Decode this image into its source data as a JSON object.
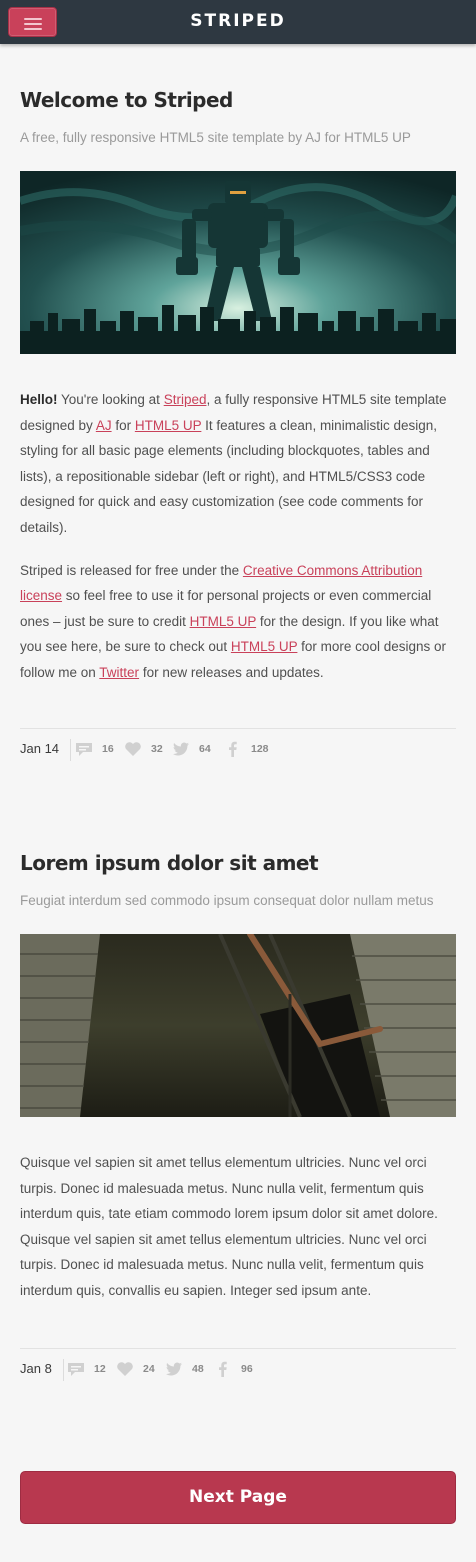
{
  "header": {
    "title": "STRIPED",
    "menu_icon": "menu-icon"
  },
  "posts": [
    {
      "title": "Welcome to Striped",
      "subtitle": "A free, fully responsive HTML5 site template by AJ for HTML5 UP",
      "paragraph1": {
        "hello": "Hello!",
        "t1": " You're looking at ",
        "link1": "Striped",
        "t2": ", a fully responsive HTML5 site template designed by ",
        "link2": "AJ",
        "t3": " for ",
        "link3": "HTML5 UP",
        "t4": " It features a clean, minimalistic design, styling for all basic page elements (including blockquotes, tables and lists), a repositionable sidebar (left or right), and HTML5/CSS3 code designed for quick and easy customization (see code comments for details)."
      },
      "paragraph2": {
        "t1": "Striped is released for free under the ",
        "link1": "Creative Commons Attribution license",
        "t2": " so feel free to use it for personal projects or even commercial ones – just be sure to credit ",
        "link2": "HTML5 UP",
        "t3": " for the design. If you like what you see here, be sure to check out ",
        "link3": "HTML5 UP",
        "t4": " for more cool designs or follow me on ",
        "link4": "Twitter",
        "t5": " for new releases and updates."
      },
      "date": "Jan 14",
      "comments": "16",
      "likes": "32",
      "tweets": "64",
      "shares": "128"
    },
    {
      "title": "Lorem ipsum dolor sit amet",
      "subtitle": "Feugiat interdum sed commodo ipsum consequat dolor nullam metus",
      "paragraph": "Quisque vel sapien sit amet tellus elementum ultricies. Nunc vel orci turpis. Donec id malesuada metus. Nunc nulla velit, fermentum quis interdum quis, tate etiam commodo lorem ipsum dolor sit amet dolore. Quisque vel sapien sit amet tellus elementum ultricies. Nunc vel orci turpis. Donec id malesuada metus. Nunc nulla velit, fermentum quis interdum quis, convallis eu sapien. Integer sed ipsum ante.",
      "date": "Jan 8",
      "comments": "12",
      "likes": "24",
      "tweets": "48",
      "shares": "96"
    }
  ],
  "pagination": {
    "next_label": "Next Page"
  },
  "colors": {
    "accent": "#c9415a",
    "topbar": "#2e3841"
  }
}
